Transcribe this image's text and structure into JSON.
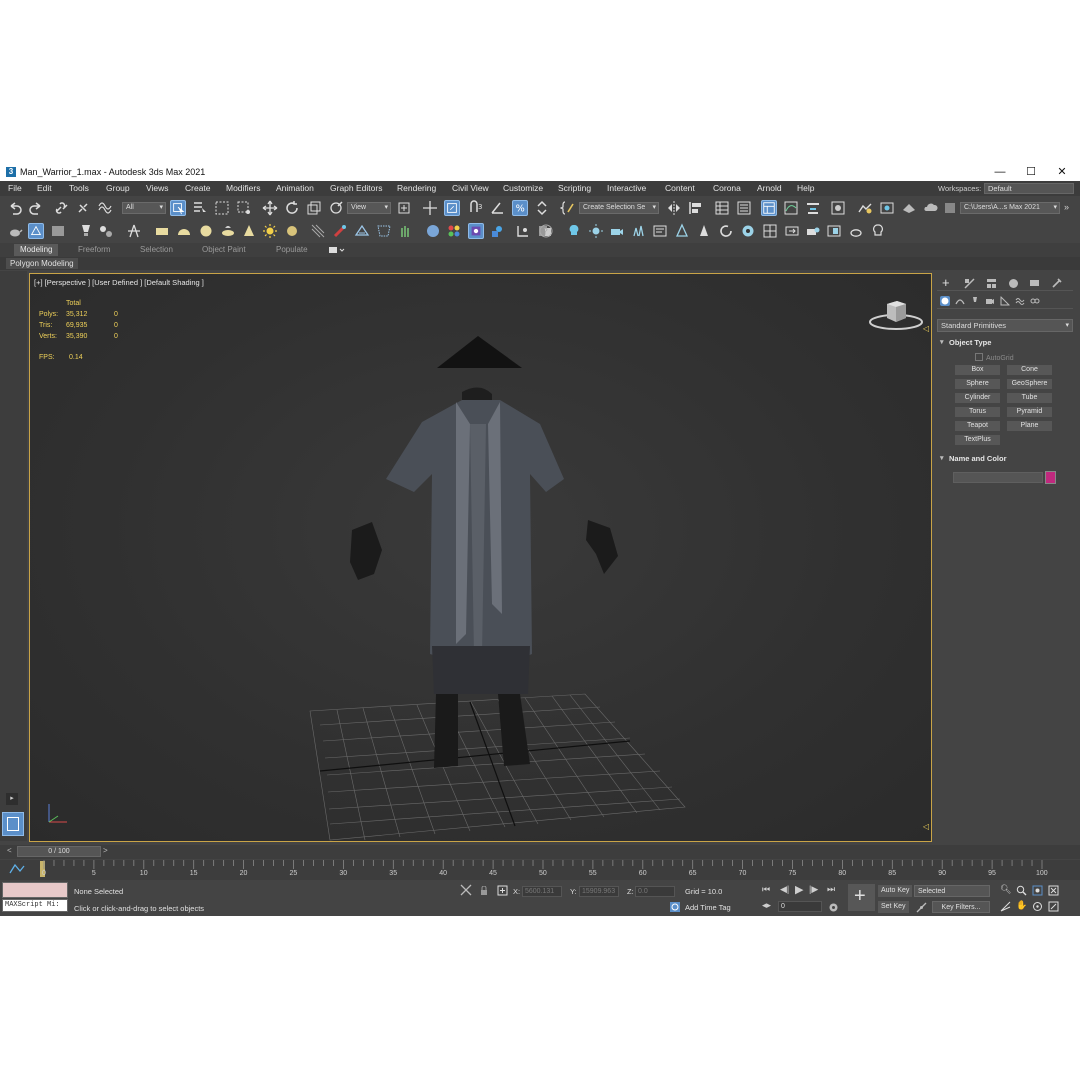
{
  "window": {
    "title": "Man_Warrior_1.max - Autodesk 3ds Max 2021",
    "icon_text": "3",
    "controls": [
      "—",
      "☐",
      "✕"
    ]
  },
  "menu": {
    "items": [
      "File",
      "Edit",
      "Tools",
      "Group",
      "Views",
      "Create",
      "Modifiers",
      "Animation",
      "Graph Editors",
      "Rendering",
      "Civil View",
      "Customize",
      "Scripting",
      "Interactive",
      "Content",
      "Corona",
      "Arnold",
      "Help"
    ],
    "workspaces_label": "Workspaces:",
    "workspace_value": "Default"
  },
  "toolbar": {
    "selection_filter": "All",
    "ref_coord": "View",
    "named_selection": "Create Selection Se",
    "project_path": "C:\\Users\\A...s Max 2021"
  },
  "ribbon": {
    "tabs": [
      "Modeling",
      "Freeform",
      "Selection",
      "Object Paint",
      "Populate"
    ],
    "active_tab": "Modeling",
    "panel_label": "Polygon Modeling"
  },
  "viewport": {
    "label": "[+] [Perspective ] [User Defined ] [Default Shading ]",
    "stats": {
      "header": "Total",
      "polys_label": "Polys:",
      "polys_total": "35,312",
      "polys_sel": "0",
      "tris_label": "Tris:",
      "tris_total": "69,935",
      "tris_sel": "0",
      "verts_label": "Verts:",
      "verts_total": "35,390",
      "verts_sel": "0",
      "fps_label": "FPS:",
      "fps_value": "0.14"
    }
  },
  "command_panel": {
    "category": "Standard Primitives",
    "object_type_title": "Object Type",
    "autogrid_label": "AutoGrid",
    "buttons": [
      "Box",
      "Cone",
      "Sphere",
      "GeoSphere",
      "Cylinder",
      "Tube",
      "Torus",
      "Pyramid",
      "Teapot",
      "Plane",
      "TextPlus"
    ],
    "name_color_title": "Name and Color",
    "object_color": "#c0297e"
  },
  "timeline": {
    "frame_display": "0 / 100",
    "tick_labels": [
      "0",
      "5",
      "10",
      "15",
      "20",
      "25",
      "30",
      "35",
      "40",
      "45",
      "50",
      "55",
      "60",
      "65",
      "70",
      "75",
      "80",
      "85",
      "90",
      "95",
      "100"
    ]
  },
  "status": {
    "selection_text": "None Selected",
    "prompt_text": "Click or click-and-drag to select objects",
    "maxscript_label": "MAXScript Mi:",
    "x_label": "X:",
    "x_value": "5600.131",
    "y_label": "Y:",
    "y_value": "15909.963",
    "z_label": "Z:",
    "z_value": "0.0",
    "grid_text": "Grid = 10.0",
    "add_time_tag": "Add Time Tag",
    "auto_key": "Auto Key",
    "set_key": "Set Key",
    "key_mode": "Selected",
    "key_filters": "Key Filters...",
    "current_frame": "0"
  }
}
